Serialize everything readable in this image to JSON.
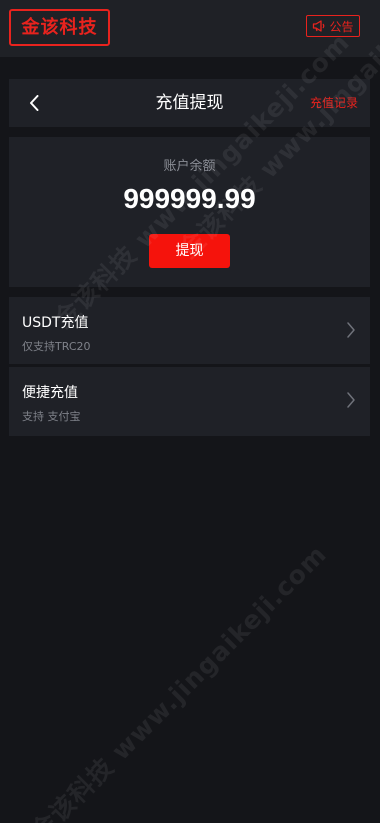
{
  "brand": {
    "logo_text": "金该科技",
    "accent_color": "#e8231e",
    "button_color": "#f5130c"
  },
  "topbar": {
    "notice_icon": "megaphone-icon",
    "notice_label": "公告"
  },
  "header": {
    "back_icon": "chevron-left-icon",
    "title": "充值提现",
    "record_link": "充值记录"
  },
  "balance": {
    "label": "账户余额",
    "value": "999999.99",
    "withdraw_label": "提现"
  },
  "options": [
    {
      "title": "USDT充值",
      "subtitle": "仅支持TRC20",
      "icon": "chevron-right-icon"
    },
    {
      "title": "便捷充值",
      "subtitle": "支持 支付宝",
      "icon": "chevron-right-icon"
    }
  ],
  "watermark": {
    "text": "金该科技 www.jingaikeji.com"
  }
}
